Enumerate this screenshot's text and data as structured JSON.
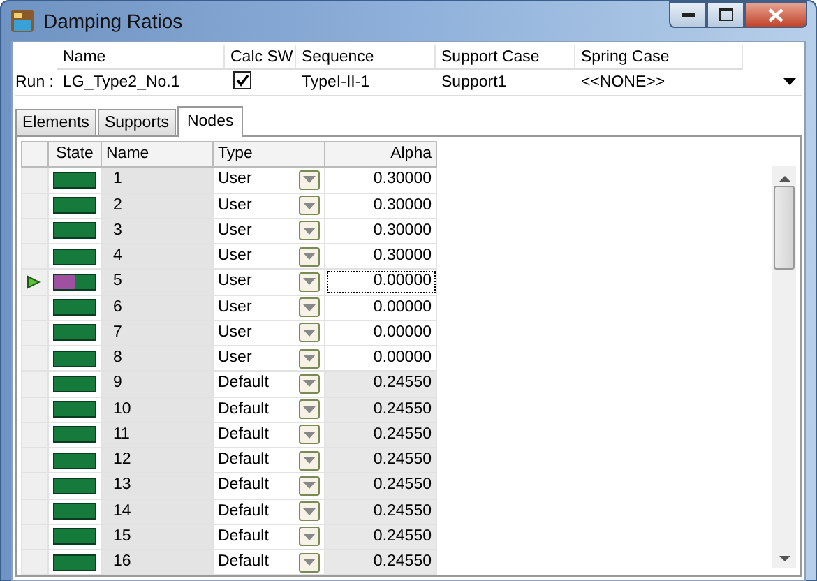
{
  "window": {
    "title": "Damping Ratios"
  },
  "run": {
    "label": "Run :",
    "columns": [
      "Name",
      "Calc SW",
      "Sequence",
      "Support Case",
      "Spring Case"
    ],
    "name": "LG_Type2_No.1",
    "calc_sw": true,
    "sequence": "TypeI-II-1",
    "support_case": "Support1",
    "spring_case": "<<NONE>>"
  },
  "tabs": [
    {
      "label": "Elements",
      "selected": false
    },
    {
      "label": "Supports",
      "selected": false
    },
    {
      "label": "Nodes",
      "selected": true
    }
  ],
  "table": {
    "columns": [
      "State",
      "Name",
      "Type",
      "Alpha"
    ],
    "rows": [
      {
        "kind": "ok",
        "name": "1",
        "type": "User",
        "alpha": "0.30000",
        "editable": true,
        "selected": false
      },
      {
        "kind": "ok",
        "name": "2",
        "type": "User",
        "alpha": "0.30000",
        "editable": true,
        "selected": false
      },
      {
        "kind": "ok",
        "name": "3",
        "type": "User",
        "alpha": "0.30000",
        "editable": true,
        "selected": false
      },
      {
        "kind": "ok",
        "name": "4",
        "type": "User",
        "alpha": "0.30000",
        "editable": true,
        "selected": false
      },
      {
        "kind": "mixed",
        "name": "5",
        "type": "User",
        "alpha": "0.00000",
        "editable": true,
        "selected": true
      },
      {
        "kind": "ok",
        "name": "6",
        "type": "User",
        "alpha": "0.00000",
        "editable": true,
        "selected": false
      },
      {
        "kind": "ok",
        "name": "7",
        "type": "User",
        "alpha": "0.00000",
        "editable": true,
        "selected": false
      },
      {
        "kind": "ok",
        "name": "8",
        "type": "User",
        "alpha": "0.00000",
        "editable": true,
        "selected": false
      },
      {
        "kind": "ok",
        "name": "9",
        "type": "Default",
        "alpha": "0.24550",
        "editable": false,
        "selected": false
      },
      {
        "kind": "ok",
        "name": "10",
        "type": "Default",
        "alpha": "0.24550",
        "editable": false,
        "selected": false
      },
      {
        "kind": "ok",
        "name": "11",
        "type": "Default",
        "alpha": "0.24550",
        "editable": false,
        "selected": false
      },
      {
        "kind": "ok",
        "name": "12",
        "type": "Default",
        "alpha": "0.24550",
        "editable": false,
        "selected": false
      },
      {
        "kind": "ok",
        "name": "13",
        "type": "Default",
        "alpha": "0.24550",
        "editable": false,
        "selected": false
      },
      {
        "kind": "ok",
        "name": "14",
        "type": "Default",
        "alpha": "0.24550",
        "editable": false,
        "selected": false
      },
      {
        "kind": "ok",
        "name": "15",
        "type": "Default",
        "alpha": "0.24550",
        "editable": false,
        "selected": false
      },
      {
        "kind": "ok",
        "name": "16",
        "type": "Default",
        "alpha": "0.24550",
        "editable": false,
        "selected": false
      }
    ]
  }
}
